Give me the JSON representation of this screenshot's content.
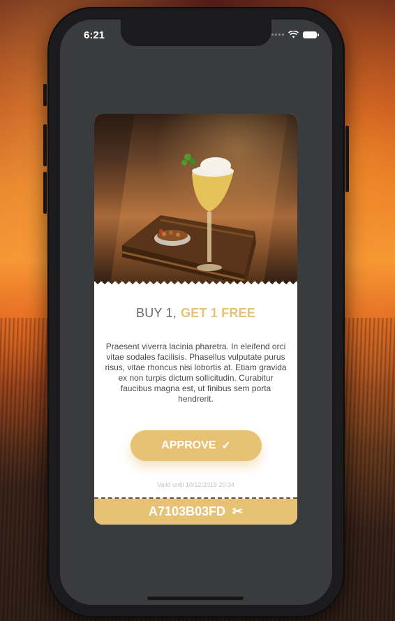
{
  "status_bar": {
    "time": "6:21"
  },
  "coupon": {
    "title_prefix": "BUY 1,",
    "title_highlight": "GET 1 FREE",
    "description": "Praesent viverra lacinia pharetra. In eleifend orci vitae sodales facilisis. Phasellus vulputate purus risus, vitae rhoncus nisi lobortis at. Etiam gravida ex non turpis dictum sollicitudin. Curabitur faucibus magna est, ut finibus sem porta hendrerit.",
    "approve_label": "APPROVE",
    "approve_check": "✓",
    "valid_until": "Valid until 10/12/2019 20:34",
    "code": "A7103B03FD",
    "scissors": "✂"
  },
  "colors": {
    "accent": "#e8c274",
    "screen_bg": "#3a3b3d"
  },
  "icons": {
    "wifi": "wifi-icon",
    "battery": "battery-icon",
    "check": "check-icon",
    "scissors": "scissors-icon"
  }
}
